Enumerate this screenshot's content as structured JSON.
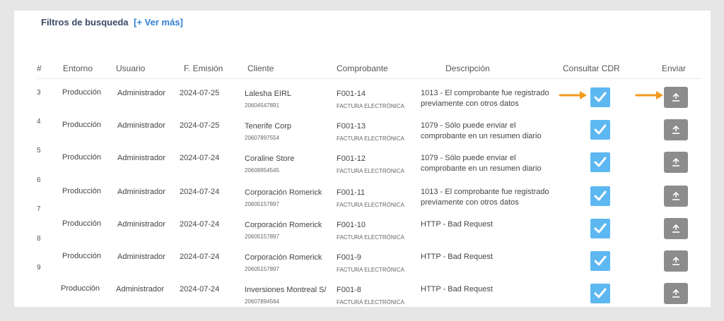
{
  "filters": {
    "title": "Filtros de busqueda",
    "more_link": "[+ Ver más]"
  },
  "table": {
    "headers": [
      "#",
      "Entorno",
      "Usuario",
      "F. Emisión",
      "Cliente",
      "Comprobante",
      "Descripción",
      "Consultar CDR",
      "Enviar"
    ],
    "rows": [
      {
        "num": "3",
        "entorno": "Producción",
        "usuario": "Administrador",
        "fecha": "2024-07-25",
        "cliente": "Lalesha EIRL",
        "ruc": "20604547891",
        "comprobante": "F001-14",
        "tipo": "FACTURA ELECTRÓNICA",
        "descripcion": "1013 - El comprobante fue registrado previamente con otros datos"
      },
      {
        "num": "4",
        "entorno": "Producción",
        "usuario": "Administrador",
        "fecha": "2024-07-25",
        "cliente": "Tenerife Corp",
        "ruc": "20607897554",
        "comprobante": "F001-13",
        "tipo": "FACTURA ELECTRÓNICA",
        "descripcion": "1079 - Sólo puede enviar el comprobante en un resumen diario"
      },
      {
        "num": "5",
        "entorno": "Producción",
        "usuario": "Administrador",
        "fecha": "2024-07-24",
        "cliente": "Coraline Store",
        "ruc": "20608954545",
        "comprobante": "F001-12",
        "tipo": "FACTURA ELECTRÓNICA",
        "descripcion": "1079 - Sólo puede enviar el comprobante en un resumen diario"
      },
      {
        "num": "6",
        "entorno": "Producción",
        "usuario": "Administrador",
        "fecha": "2024-07-24",
        "cliente": "Corporación Romerick",
        "ruc": "20605157897",
        "comprobante": "F001-11",
        "tipo": "FACTURA ELECTRÓNICA",
        "descripcion": "1013 - El comprobante fue registrado previamente con otros datos"
      },
      {
        "num": "7",
        "entorno": "Producción",
        "usuario": "Administrador",
        "fecha": "2024-07-24",
        "cliente": "Corporación Romerick",
        "ruc": "20605157897",
        "comprobante": "F001-10",
        "tipo": "FACTURA ELECTRÓNICA",
        "descripcion": "HTTP - Bad Request"
      },
      {
        "num": "8",
        "entorno": "Producción",
        "usuario": "Administrador",
        "fecha": "2024-07-24",
        "cliente": "Corporación Romerick",
        "ruc": "20605157897",
        "comprobante": "F001-9",
        "tipo": "FACTURA ELECTRÓNICA",
        "descripcion": "HTTP - Bad Request"
      },
      {
        "num": "9",
        "entorno": "Producción",
        "usuario": "Administrador",
        "fecha": "2024-07-24",
        "cliente": "Inversiones Montreal S/",
        "ruc": "20607894564",
        "comprobante": "F001-8",
        "tipo": "FACTURA ELECTRÓNICA",
        "descripcion": "HTTP - Bad Request"
      }
    ]
  },
  "icons": {
    "cdr": "checkmark-icon",
    "send": "upload-icon",
    "annotation": "orange-arrow-icon"
  },
  "colors": {
    "cdr_checkbox": "#5db8f2",
    "send_button": "#8c8c8c",
    "annotation_arrow": "#f29a1f",
    "link": "#2f7fd6"
  }
}
